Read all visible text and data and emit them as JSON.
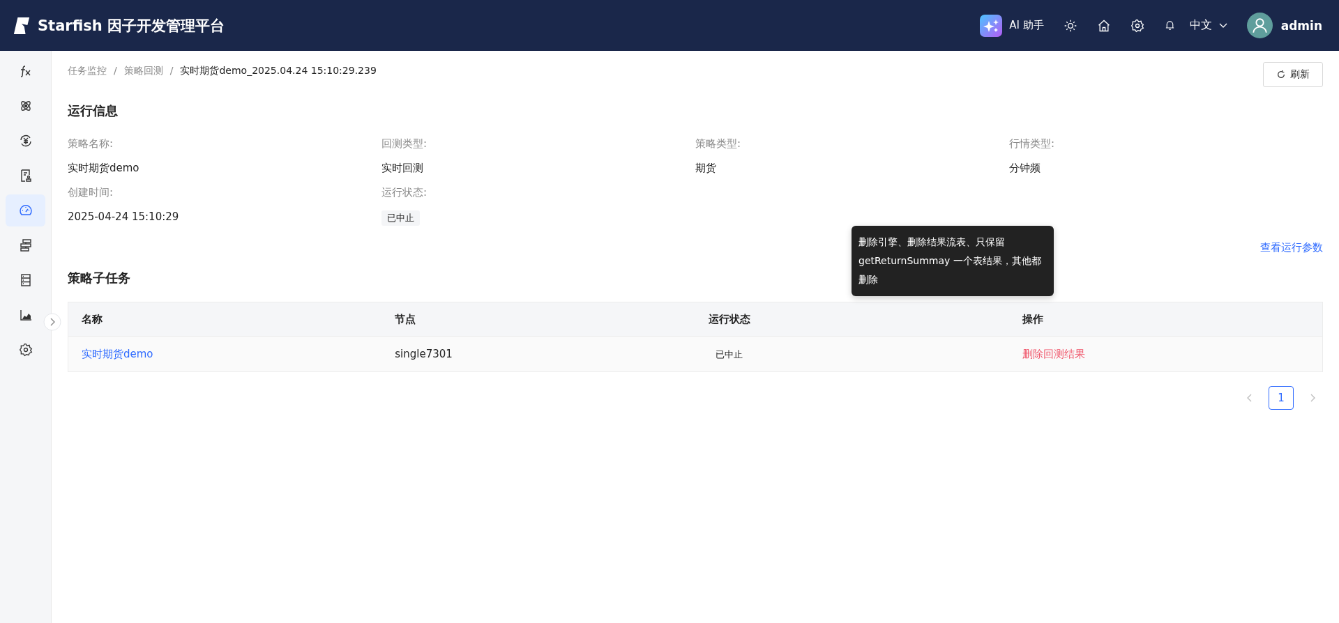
{
  "header": {
    "brand": "Starfish 因子开发管理平台",
    "ai_label": "AI 助手",
    "language": "中文",
    "user": "admin"
  },
  "sidebar": {
    "items": [
      {
        "kind": "fx",
        "selected": false
      },
      {
        "kind": "atom",
        "selected": false
      },
      {
        "kind": "yen",
        "selected": false
      },
      {
        "kind": "doc",
        "selected": false
      },
      {
        "kind": "gauge",
        "selected": true
      },
      {
        "kind": "flow",
        "selected": false
      },
      {
        "kind": "server",
        "selected": false
      },
      {
        "kind": "chart",
        "selected": false
      },
      {
        "kind": "gear",
        "selected": false
      }
    ]
  },
  "breadcrumb": {
    "separator": "/",
    "items": [
      "任务监控",
      "策略回测",
      "实时期货demo_2025.04.24 15:10:29.239"
    ]
  },
  "refresh_button": "刷新",
  "run_info": {
    "title": "运行信息",
    "fields": [
      {
        "label": "策略名称:",
        "value": "实时期货demo",
        "kind": "text"
      },
      {
        "label": "回测类型:",
        "value": "实时回测",
        "kind": "text"
      },
      {
        "label": "策略类型:",
        "value": "期货",
        "kind": "text"
      },
      {
        "label": "行情类型:",
        "value": "分钟频",
        "kind": "text"
      },
      {
        "label": "创建时间:",
        "value": "2025-04-24 15:10:29",
        "kind": "text"
      },
      {
        "label": "运行状态:",
        "value": "已中止",
        "kind": "tag"
      }
    ],
    "params_link": "查看运行参数"
  },
  "subtasks": {
    "title": "策略子任务",
    "columns": [
      "名称",
      "节点",
      "运行状态",
      "操作"
    ],
    "rows": [
      {
        "name": "实时期货demo",
        "node": "single7301",
        "status": "已中止",
        "action": "删除回测结果"
      }
    ],
    "tooltip": "删除引擎、删除结果流表、只保留getReturnSummay 一个表结果，其他都删除"
  },
  "pagination": {
    "pages": [
      {
        "label": "1",
        "selected": true
      }
    ]
  }
}
